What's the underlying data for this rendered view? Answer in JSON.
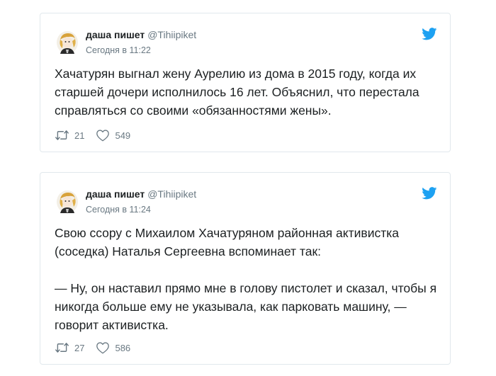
{
  "tweets": [
    {
      "user": {
        "name": "даша пишет",
        "handle": "@Tihiipiket"
      },
      "timestamp": "Сегодня в 11:22",
      "text_lines": [
        "Хачатурян выгнал жену Аурелию из дома в 2015 году, когда их",
        "старшей дочери исполнилось 16 лет. Объяснил, что перестала",
        "справляться со своими «обязанностями жены»."
      ],
      "retweets": "21",
      "likes": "549"
    },
    {
      "user": {
        "name": "даша пишет",
        "handle": "@Tihiipiket"
      },
      "timestamp": "Сегодня в 11:24",
      "text_lines": [
        "Свою ссору с Михаилом Хачатуряном районная активистка",
        "(соседка) Наталья Сергеевна вспоминает так:",
        "— Ну, он наставил прямо мне в голову пистолет и сказал, чтобы я",
        "никогда больше ему не указывала, как парковать машину, —",
        "говорит активистка."
      ],
      "retweets": "27",
      "likes": "586"
    }
  ],
  "colors": {
    "twitter_blue": "#1da1f2",
    "text": "#1c2022",
    "muted": "#697882",
    "border": "#e1e8ed"
  },
  "icons": {
    "brand": "twitter-bird-icon",
    "retweet": "retweet-icon",
    "like": "heart-icon"
  }
}
